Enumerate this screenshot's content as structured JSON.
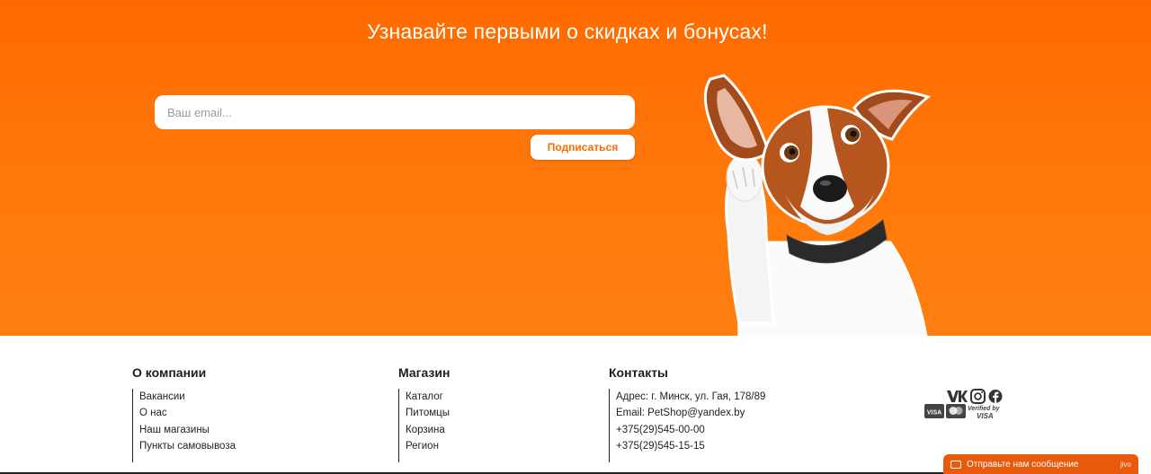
{
  "subscribe": {
    "title": "Узнавайте первыми о скидках и бонусах!",
    "email_placeholder": "Ваш email...",
    "email_value": "",
    "button_label": "Подписаться"
  },
  "footer": {
    "about": {
      "heading": "О компании",
      "items": [
        "Вакансии",
        "О нас",
        "Наш магазины",
        "Пункты самовывоза"
      ]
    },
    "shop": {
      "heading": "Магазин",
      "items": [
        "Каталог",
        "Питомцы",
        "Корзина",
        "Регион"
      ]
    },
    "contacts": {
      "heading": "Контакты",
      "items": [
        "Адрес: г. Минск, ул. Гая, 178/89",
        "Email: PetShop@yandex.by",
        "+375(29)545-00-00",
        "+375(29)545-15-15"
      ]
    },
    "socials": [
      "vk-icon",
      "instagram-icon",
      "facebook-icon"
    ],
    "payments": [
      "VISA",
      "mastercard-icon",
      "Verified by",
      "VISA"
    ]
  },
  "chat": {
    "label": "Отправьте нам сообщение",
    "brand": "jivo"
  },
  "colors": {
    "accent": "#ff6a00",
    "chat": "#ea5a0c"
  }
}
